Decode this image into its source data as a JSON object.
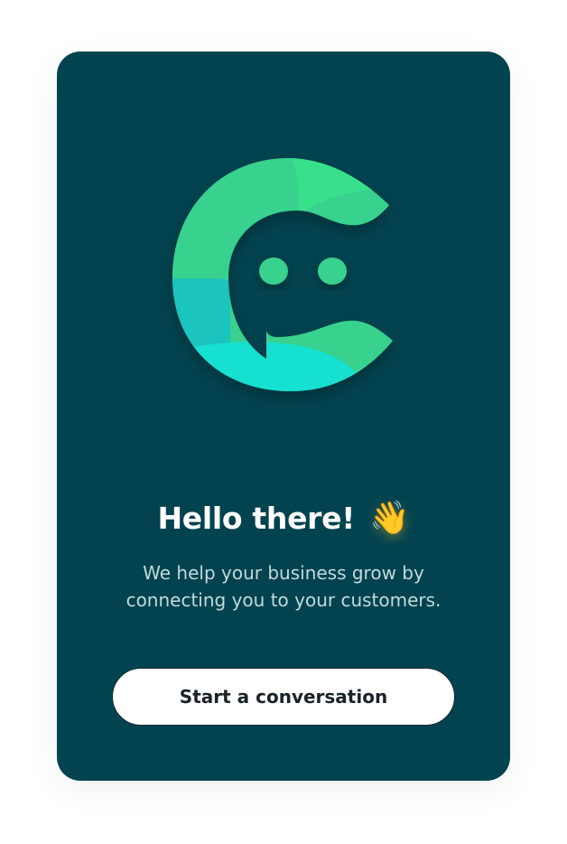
{
  "greeting": {
    "title": "Hello there!",
    "emoji": "👋"
  },
  "tagline": "We help your business grow by connecting you to your customers.",
  "cta": {
    "label": "Start a conversation"
  },
  "logo": {
    "icon": "chat-c-logo-icon",
    "colors": {
      "card_background": "#02434f",
      "green_light": "#38e08b",
      "green_mid": "#37d18d",
      "teal": "#1bc4be",
      "cyan": "#15e0cf"
    }
  }
}
